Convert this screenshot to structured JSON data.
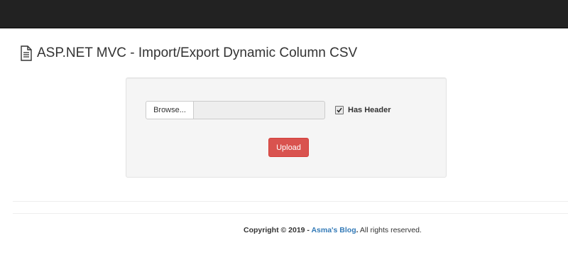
{
  "page": {
    "title": "ASP.NET MVC - Import/Export Dynamic Column CSV",
    "title_icon": "document-icon"
  },
  "upload_form": {
    "browse_label": "Browse...",
    "file_path_value": "",
    "has_header_checked": true,
    "has_header_label": "Has Header",
    "upload_label": "Upload"
  },
  "footer": {
    "copyright_prefix": "Copyright © 2019 - ",
    "blog_link": "Asma's Blog",
    "dot": ".",
    "suffix": " All rights reserved."
  },
  "colors": {
    "navbar": "#222222",
    "upload_button": "#d9534f",
    "link": "#337ab7",
    "well_background": "#f5f5f5"
  }
}
